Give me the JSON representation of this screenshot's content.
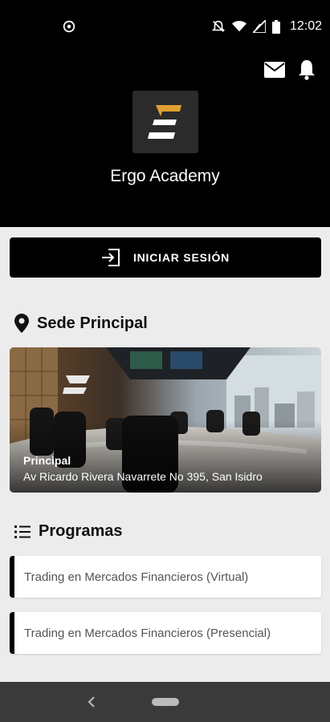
{
  "status": {
    "time": "12:02",
    "icons": [
      "sync-icon",
      "notifications-off-icon",
      "wifi-icon",
      "signal-icon",
      "battery-icon"
    ]
  },
  "header": {
    "icons": [
      "mail-icon",
      "bell-icon"
    ],
    "app_title": "Ergo Academy",
    "logo": "ergo-logo",
    "logo_letter": "E"
  },
  "login": {
    "label": "INICIAR SESIÓN",
    "icon": "login-icon"
  },
  "sede": {
    "section_title": "Sede Principal",
    "icon": "location-pin-icon",
    "card": {
      "name": "Principal",
      "address": "Av Ricardo Rivera Navarrete No 395, San Isidro"
    }
  },
  "programas": {
    "section_title": "Programas",
    "icon": "list-icon",
    "items": [
      {
        "label": "Trading en Mercados Financieros (Virtual)"
      },
      {
        "label": "Trading en Mercados Financieros (Presencial)"
      }
    ]
  },
  "colors": {
    "header_bg": "#000000",
    "page_bg": "#ececec",
    "accent": "#e0a030"
  }
}
